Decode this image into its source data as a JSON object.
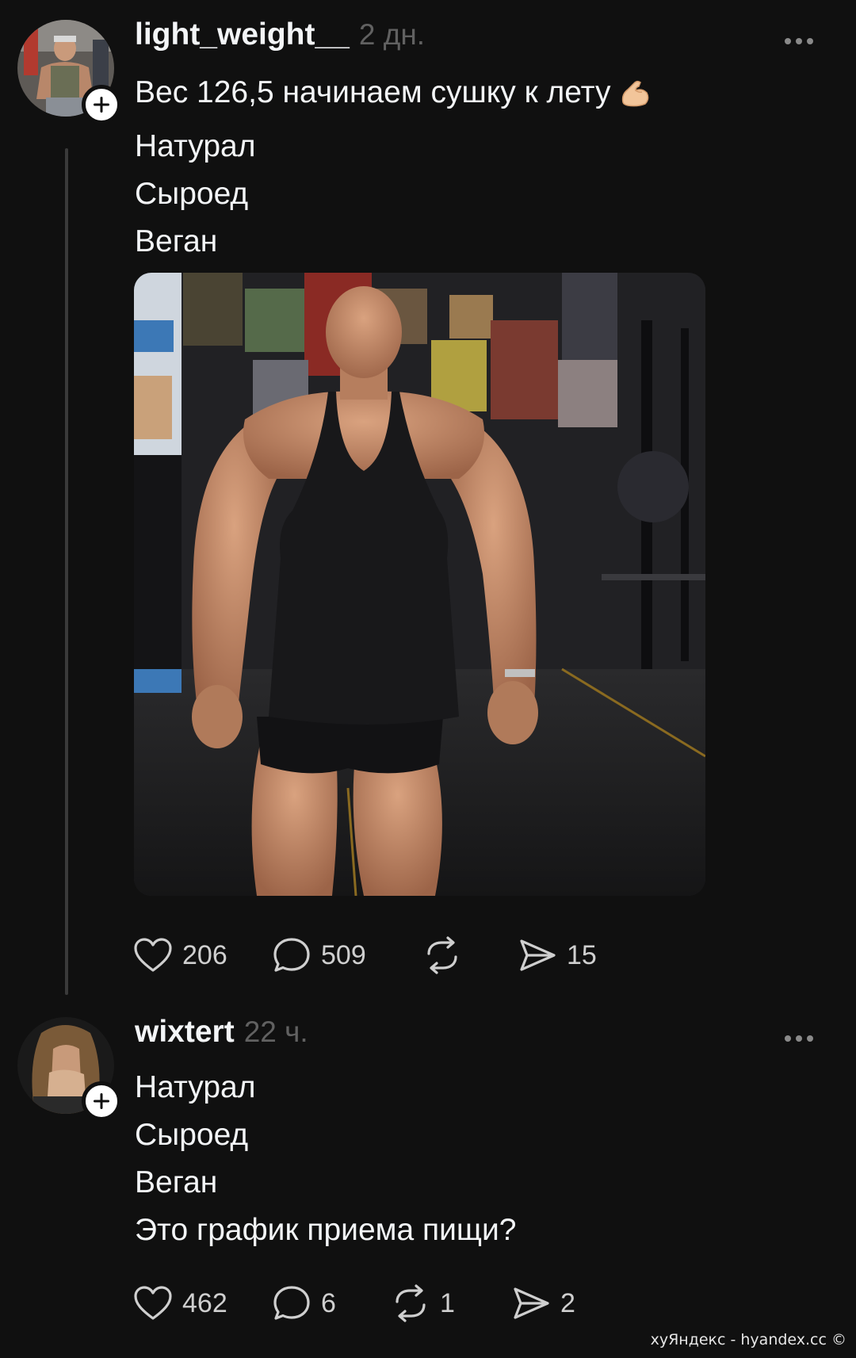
{
  "posts": [
    {
      "username": "light_weight__",
      "time": "2 дн.",
      "lines": [
        "Вес 126,5 начинаем сушку к лету",
        "Натурал",
        "Сыроед",
        "Веган"
      ],
      "emoji": "flexed-biceps",
      "has_image": true,
      "actions": {
        "likes": "206",
        "comments": "509",
        "reposts": "",
        "shares": "15"
      }
    },
    {
      "username": "wixtert",
      "time": "22 ч.",
      "lines": [
        "Натурал",
        "Сыроед",
        "Веган",
        "Это график приема пищи?"
      ],
      "actions": {
        "likes": "462",
        "comments": "6",
        "reposts": "1",
        "shares": "2"
      }
    }
  ],
  "icons": {
    "like": "heart-icon",
    "comment": "speech-bubble-icon",
    "repost": "repost-icon",
    "share": "send-icon",
    "more": "more-dots-icon",
    "follow": "plus-icon"
  },
  "colors": {
    "background": "#101010",
    "text": "#f3f5f7",
    "secondary": "#616161",
    "thread_line": "#3a3a3a"
  },
  "watermark": "хуЯндекс - hyandex.cc ©"
}
